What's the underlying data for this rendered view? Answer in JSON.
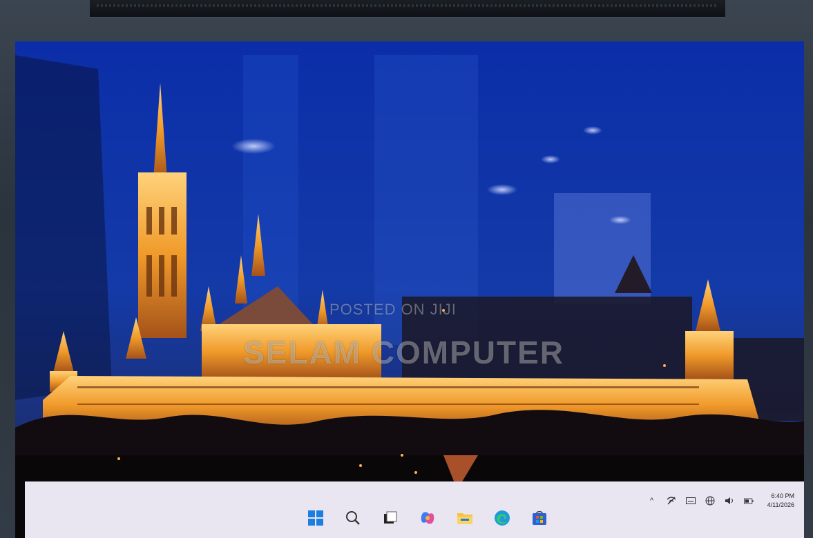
{
  "watermark": {
    "line1": "POSTED ON JIJI",
    "line2": "SELAM COMPUTER"
  },
  "taskbar": {
    "icons": [
      "windows-start-icon",
      "search-icon",
      "task-view-icon",
      "copilot-icon",
      "file-explorer-icon",
      "edge-browser-icon",
      "microsoft-store-icon"
    ]
  },
  "tray": {
    "chevron": "^",
    "icons": [
      "show-hidden-icons-chevron",
      "network-off-icon",
      "keyboard-icon",
      "globe-language-icon",
      "volume-icon",
      "battery-icon"
    ]
  },
  "clock": {
    "time": "6:40 PM",
    "date": "4/11/2026"
  },
  "colors": {
    "sky": "#1a3fb0",
    "taskbar": "#e9e6f2",
    "castle_light": "#f0a030"
  }
}
